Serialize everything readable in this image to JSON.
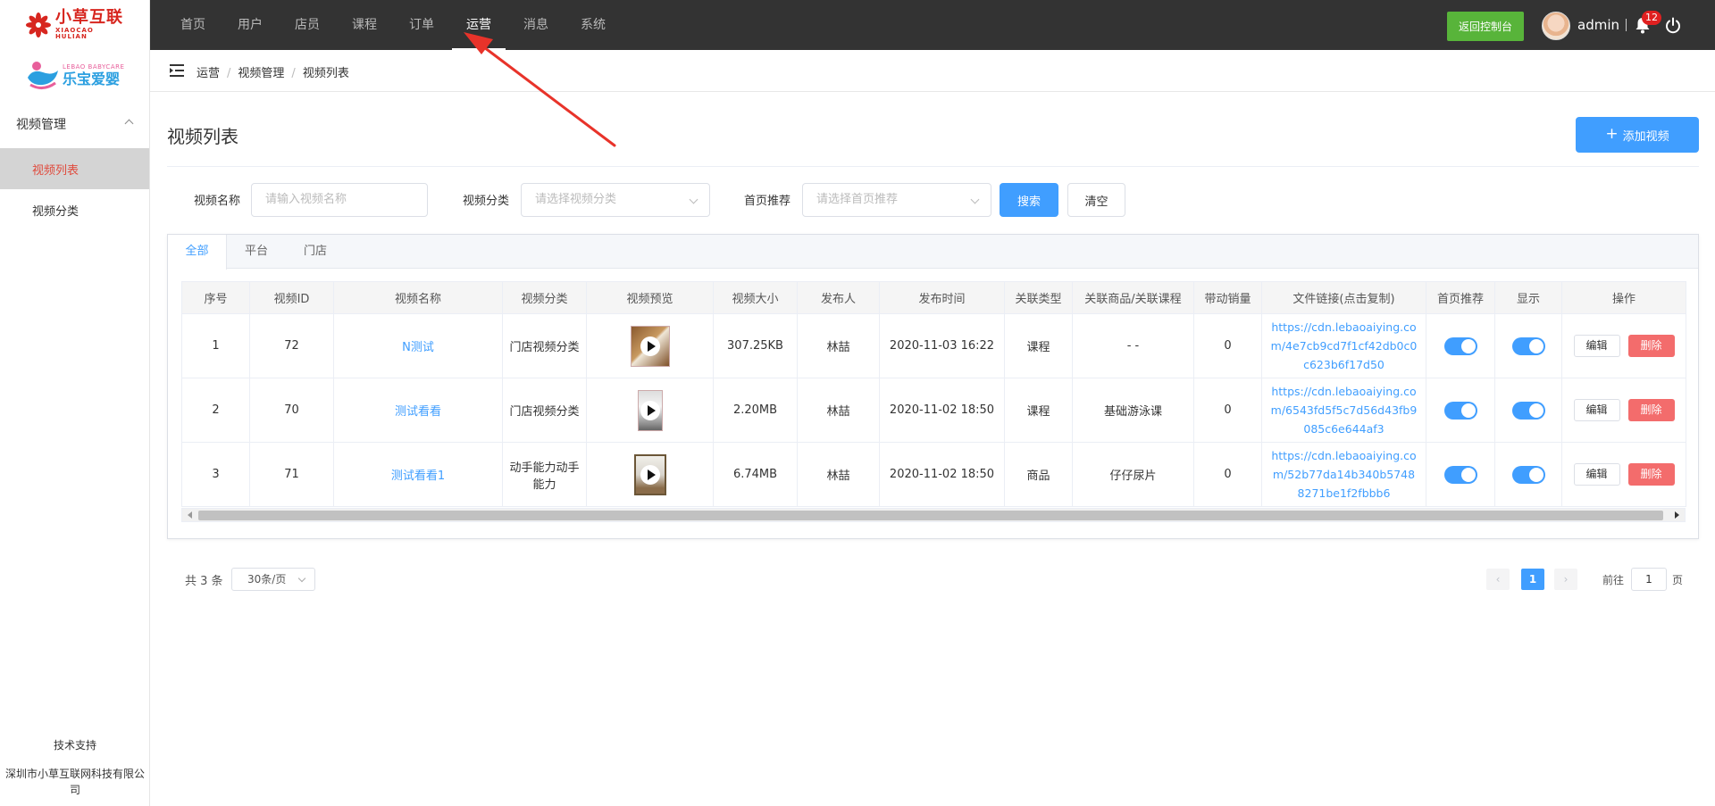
{
  "brand": {
    "logo_cn": "小草互联",
    "logo_en": "XIAOCAO HULIAN",
    "sub_logo_en": "LEBAO BABYCARE",
    "sub_logo_cn": "乐宝爱婴"
  },
  "sidebar": {
    "group_label": "视频管理",
    "items": [
      {
        "label": "视频列表",
        "active": true
      },
      {
        "label": "视频分类",
        "active": false
      }
    ],
    "support_label": "技术支持",
    "company": "深圳市小草互联网科技有限公司"
  },
  "topnav": {
    "items": [
      "首页",
      "用户",
      "店员",
      "课程",
      "订单",
      "运营",
      "消息",
      "系统"
    ],
    "active": "运营",
    "console_button": "返回控制台",
    "username": "admin",
    "notification_count": "12"
  },
  "breadcrumb": [
    "运营",
    "视频管理",
    "视频列表"
  ],
  "page": {
    "title": "视频列表",
    "add_button": "添加视频"
  },
  "filters": {
    "name_label": "视频名称",
    "name_placeholder": "请输入视频名称",
    "category_label": "视频分类",
    "category_placeholder": "请选择视频分类",
    "recommend_label": "首页推荐",
    "recommend_placeholder": "请选择首页推荐",
    "search_button": "搜索",
    "clear_button": "清空"
  },
  "tabs": [
    "全部",
    "平台",
    "门店"
  ],
  "active_tab": "全部",
  "table": {
    "columns": [
      "序号",
      "视频ID",
      "视频名称",
      "视频分类",
      "视频预览",
      "视频大小",
      "发布人",
      "发布时间",
      "关联类型",
      "关联商品/关联课程",
      "带动销量",
      "文件链接(点击复制)",
      "首页推荐",
      "显示",
      "操作"
    ],
    "edit_label": "编辑",
    "delete_label": "删除",
    "rows": [
      {
        "no": "1",
        "id": "72",
        "name": "N测试",
        "category": "门店视频分类",
        "size": "307.25KB",
        "publisher": "林喆",
        "time": "2020-11-03 16:22",
        "type": "课程",
        "related": "- -",
        "sales": "0",
        "url": "https://cdn.lebaoaiying.com/4e7cb9cd7f1cf42db0c0c623b6f17d50",
        "recommend": true,
        "visible": true
      },
      {
        "no": "2",
        "id": "70",
        "name": "测试看看",
        "category": "门店视频分类",
        "size": "2.20MB",
        "publisher": "林喆",
        "time": "2020-11-02 18:50",
        "type": "课程",
        "related": "基础游泳课",
        "sales": "0",
        "url": "https://cdn.lebaoaiying.com/6543fd5f5c7d56d43fb9085c6e644af3",
        "recommend": true,
        "visible": true
      },
      {
        "no": "3",
        "id": "71",
        "name": "测试看看1",
        "category": "动手能力动手能力",
        "size": "6.74MB",
        "publisher": "林喆",
        "time": "2020-11-02 18:50",
        "type": "商品",
        "related": "仔仔尿片",
        "sales": "0",
        "url": "https://cdn.lebaoaiying.com/52b77da14b340b57488271be1f2fbbb6",
        "recommend": true,
        "visible": true
      }
    ]
  },
  "pagination": {
    "total_text": "共 3 条",
    "page_size": "30条/页",
    "current_page": "1",
    "goto_label": "前往",
    "goto_value": "1",
    "goto_suffix": "页"
  },
  "colors": {
    "topbar": "#333333",
    "primary": "#409eff",
    "console_button": "#58b43a",
    "danger": "#f36c6c",
    "sidebar_active_text": "#e04a3c",
    "annotation_arrow": "#e8332a"
  }
}
